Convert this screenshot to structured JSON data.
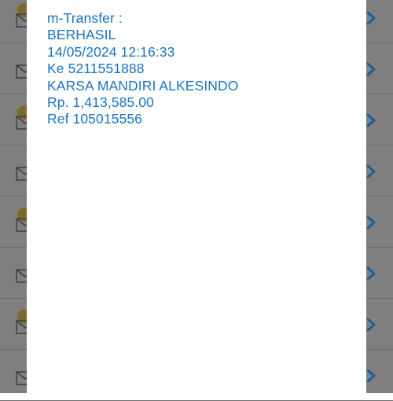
{
  "message": {
    "lines": [
      "m-Transfer :",
      "BERHASIL",
      "14/05/2024 12:16:33",
      "Ke 5211551888",
      "KARSA MANDIRI ALKESINDO",
      "Rp. 1,413,585.00",
      "Ref 105015556"
    ]
  },
  "background": {
    "list_rows": 8,
    "row_icon": "envelope-icon",
    "row_action_icon": "chevron-right-icon"
  },
  "colors": {
    "message_text": "#1a73c2",
    "dialog_bg": "#ffffff",
    "overlay_bg": "#7f7f7f",
    "chevron": "#1a5f97"
  }
}
